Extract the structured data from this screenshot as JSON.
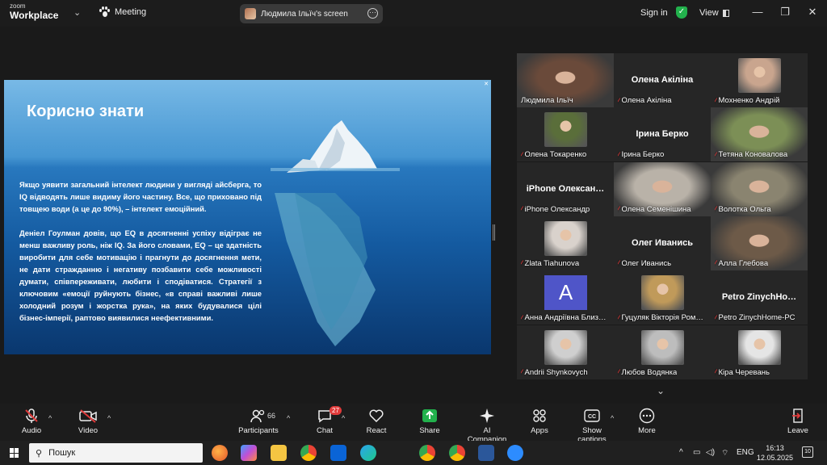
{
  "window": {
    "brand_small": "zoom",
    "brand_large": "Workplace",
    "meeting_label": "Meeting",
    "share_pill": "Людмила Ільїч's screen",
    "sign_in": "Sign in",
    "view": "View"
  },
  "slide": {
    "title": "Корисно знати",
    "paragraph1": "Якщо уявити загальний інтелект людини у вигляді айсберга, то IQ відводять лише видиму його частину. Все, що приховано під товщею води (а це до 90%), – інтелект емоційний.",
    "paragraph2": "Деніел Гоулман довів, що EQ в досягненні успіху відіграє не менш важливу роль, ніж IQ. За його словами, EQ – це здатність виробити для себе мотивацію і прагнути до досягнення мети, не дати стражданню і негативу позбавити себе можливості думати, співпереживати, любити і сподіватися. Стратегії з ключовим «емоції руйнують бізнес, «в справі важливі лише холодний розум і жорстка рука», на яких будувалися цілі бізнес-імперії, раптово виявилися неефективними."
  },
  "participants": [
    {
      "name": "Людмила Ільїч",
      "video": true,
      "muted": false,
      "color": "#6a4a3a"
    },
    {
      "name": "Олена Акіліна",
      "big": "Олена Акіліна",
      "muted": true
    },
    {
      "name": "Мохненко Андрій",
      "photo": true,
      "muted": true,
      "color": "#c9a58e"
    },
    {
      "name": "Олена Токаренко",
      "photo": true,
      "muted": true,
      "color": "#5a6e3a"
    },
    {
      "name": "Ірина Берко",
      "big": "Ірина Берко",
      "muted": true
    },
    {
      "name": "Тетяна Коновалова",
      "video": true,
      "muted": true,
      "color": "#7c8f56"
    },
    {
      "name": "iPhone Олександр",
      "big": "iPhone Олексан…",
      "muted": true
    },
    {
      "name": "Олена Семенішина",
      "video": true,
      "muted": true,
      "color": "#b9b2a8"
    },
    {
      "name": "Волотка Ольга",
      "video": true,
      "muted": true,
      "color": "#8a8470"
    },
    {
      "name": "Zlata Tiahunova",
      "photo": true,
      "muted": true,
      "color": "#d9d2cc"
    },
    {
      "name": "Олег Иванись",
      "big": "Олег Иванись",
      "muted": true
    },
    {
      "name": "Алла Глебова",
      "video": true,
      "muted": true,
      "color": "#6d5a48"
    },
    {
      "name": "Анна Андріївна Близ…",
      "letter": "A",
      "muted": true
    },
    {
      "name": "Гуцуляк Вікторія Ром…",
      "photo": true,
      "muted": true,
      "color": "#c09a5a"
    },
    {
      "name": "Petro ZinychHome-PC",
      "big": "Petro  ZinychHo…",
      "muted": true
    },
    {
      "name": "Andrii Shynkovych",
      "photo": true,
      "muted": true,
      "color": "#cfcfcf"
    },
    {
      "name": "Любов Водянка",
      "photo": true,
      "muted": true,
      "color": "#bdbdbd"
    },
    {
      "name": "Кіра Черевань",
      "photo": true,
      "muted": true,
      "color": "#e5e5e5"
    }
  ],
  "toolbar": {
    "audio": "Audio",
    "video": "Video",
    "participants": "Participants",
    "participants_count": "66",
    "chat": "Chat",
    "chat_badge": "27",
    "react": "React",
    "share": "Share",
    "ai": "AI Companion",
    "apps": "Apps",
    "captions": "Show captions",
    "more": "More",
    "leave": "Leave"
  },
  "taskbar": {
    "search": "Пошук",
    "lang": "ENG",
    "time": "16:13",
    "date": "12.05.2025",
    "notifications": "10"
  },
  "colors": {
    "accent_green": "#2ed06e",
    "share_green": "#22b14c",
    "leave_red": "#e03a3a"
  }
}
